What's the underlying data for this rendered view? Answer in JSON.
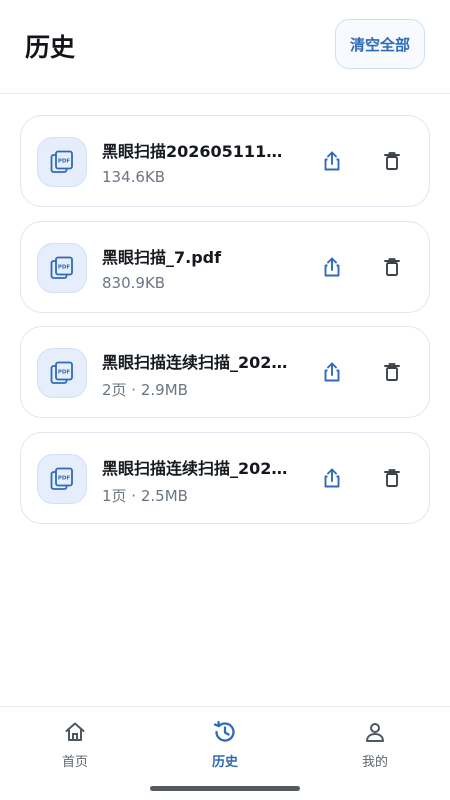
{
  "header": {
    "title": "历史",
    "clear_all_label": "清空全部"
  },
  "files": [
    {
      "name": "黑眼扫描20260511151…",
      "meta": "134.6KB",
      "icon": "pdf-file-icon"
    },
    {
      "name": "黑眼扫描_7.pdf",
      "meta": "830.9KB",
      "icon": "pdf-file-icon"
    },
    {
      "name": "黑眼扫描连续扫描_202…",
      "meta": "2页 · 2.9MB",
      "icon": "pdf-file-icon"
    },
    {
      "name": "黑眼扫描连续扫描_202…",
      "meta": "1页 · 2.5MB",
      "icon": "pdf-file-icon"
    }
  ],
  "icon_text": "PDF",
  "bottom_nav": {
    "items": [
      {
        "label": "首页",
        "icon": "home-icon",
        "active": false
      },
      {
        "label": "历史",
        "icon": "history-icon",
        "active": true
      },
      {
        "label": "我的",
        "icon": "person-icon",
        "active": false
      }
    ]
  },
  "colors": {
    "accent": "#2f6bb5",
    "icon_bg": "#e6eefb",
    "border": "#dfe7f1",
    "muted_text": "#6b7682"
  }
}
